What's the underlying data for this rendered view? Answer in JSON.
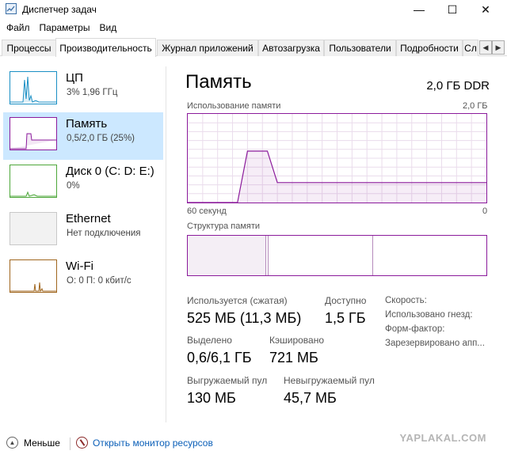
{
  "window": {
    "title": "Диспетчер задач",
    "minimize_glyph": "—",
    "maximize_glyph": "☐",
    "close_glyph": "✕"
  },
  "menu": [
    "Файл",
    "Параметры",
    "Вид"
  ],
  "tabs": [
    {
      "label": "Процессы",
      "active": false
    },
    {
      "label": "Производительность",
      "active": true
    },
    {
      "label": "Журнал приложений",
      "active": false
    },
    {
      "label": "Автозагрузка",
      "active": false
    },
    {
      "label": "Пользователи",
      "active": false
    },
    {
      "label": "Подробности",
      "active": false
    },
    {
      "label": "Сл",
      "active": false
    }
  ],
  "tab_scroll": {
    "left": "◀",
    "right": "▶"
  },
  "sidebar": {
    "items": [
      {
        "title": "ЦП",
        "subtitle": "3% 1,96 ГГц",
        "color": "#1a8fc4",
        "active": false
      },
      {
        "title": "Память",
        "subtitle": "0,5/2,0 ГБ (25%)",
        "color": "#8b1a9b",
        "active": true
      },
      {
        "title": "Диск 0 (C: D: E:)",
        "subtitle": "0%",
        "color": "#4da73a",
        "active": false
      },
      {
        "title": "Ethernet",
        "subtitle": "Нет подключения",
        "color": "#a0a0a0",
        "active": false
      },
      {
        "title": "Wi-Fi",
        "subtitle": "О: 0 П: 0 кбит/с",
        "color": "#a0661e",
        "active": false
      }
    ]
  },
  "main": {
    "title": "Память",
    "spec": "2,0 ГБ DDR",
    "usage_chart": {
      "label": "Использование памяти",
      "max_label": "2,0 ГБ",
      "time_left": "60 секунд",
      "time_right": "0"
    },
    "structure_label": "Структура памяти",
    "stats": {
      "in_use_label": "Используется (сжатая)",
      "in_use_value": "525 МБ (11,3 МБ)",
      "available_label": "Доступно",
      "available_value": "1,5 ГБ",
      "committed_label": "Выделено",
      "committed_value": "0,6/6,1 ГБ",
      "cached_label": "Кэшировано",
      "cached_value": "721 МБ",
      "paged_label": "Выгружаемый пул",
      "paged_value": "130 МБ",
      "nonpaged_label": "Невыгружаемый пул",
      "nonpaged_value": "45,7 МБ"
    },
    "details": [
      "Скорость:",
      "Использовано гнезд:",
      "Форм-фактор:",
      "Зарезервировано апп..."
    ]
  },
  "footer": {
    "less_label": "Меньше",
    "monitor_label": "Открыть монитор ресурсов",
    "watermark": "YAPLAKAL.COM"
  },
  "chart_data": {
    "type": "area",
    "title": "Использование памяти",
    "xlabel": "",
    "ylabel": "",
    "x_range_label": [
      "60 секунд",
      "0"
    ],
    "ylim": [
      0,
      2.0
    ],
    "units": "ГБ",
    "note": "memory usage over last 60 seconds",
    "x": [
      60,
      54,
      50,
      48,
      44,
      42,
      40,
      0
    ],
    "values": [
      0,
      0,
      0,
      1.16,
      1.16,
      0.45,
      0.45,
      0.45
    ],
    "color": "#8b1a9b",
    "grid": true
  }
}
